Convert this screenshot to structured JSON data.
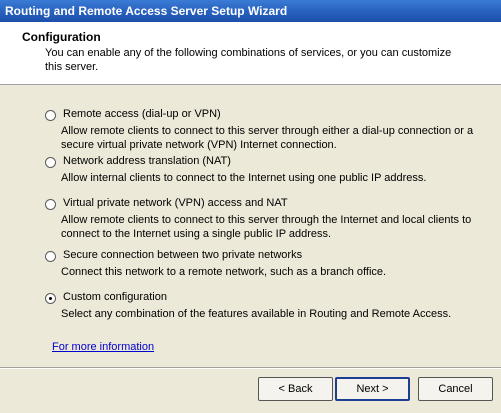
{
  "window": {
    "title": "Routing and Remote Access Server Setup Wizard"
  },
  "header": {
    "title": "Configuration",
    "description": "You can enable any of the following combinations of services, or you can customize this server."
  },
  "options": [
    {
      "label": "Remote access (dial-up or VPN)",
      "description": "Allow remote clients to connect to this server through either a dial-up connection or a secure virtual private network (VPN) Internet connection.",
      "selected": false
    },
    {
      "label": "Network address translation (NAT)",
      "description": "Allow internal clients to connect to the Internet using one public IP address.",
      "selected": false
    },
    {
      "label": "Virtual private network (VPN) access and NAT",
      "description": "Allow remote clients to connect to this server through the Internet and local clients to connect to the Internet using a single public IP address.",
      "selected": false
    },
    {
      "label": "Secure connection between two private networks",
      "description": "Connect this network to a remote network, such as a branch office.",
      "selected": false
    },
    {
      "label": "Custom configuration",
      "description": "Select any combination of the features available in Routing and Remote Access.",
      "selected": true
    }
  ],
  "more_info_link": "For more information",
  "buttons": {
    "back": "< Back",
    "next": "Next >",
    "cancel": "Cancel"
  }
}
